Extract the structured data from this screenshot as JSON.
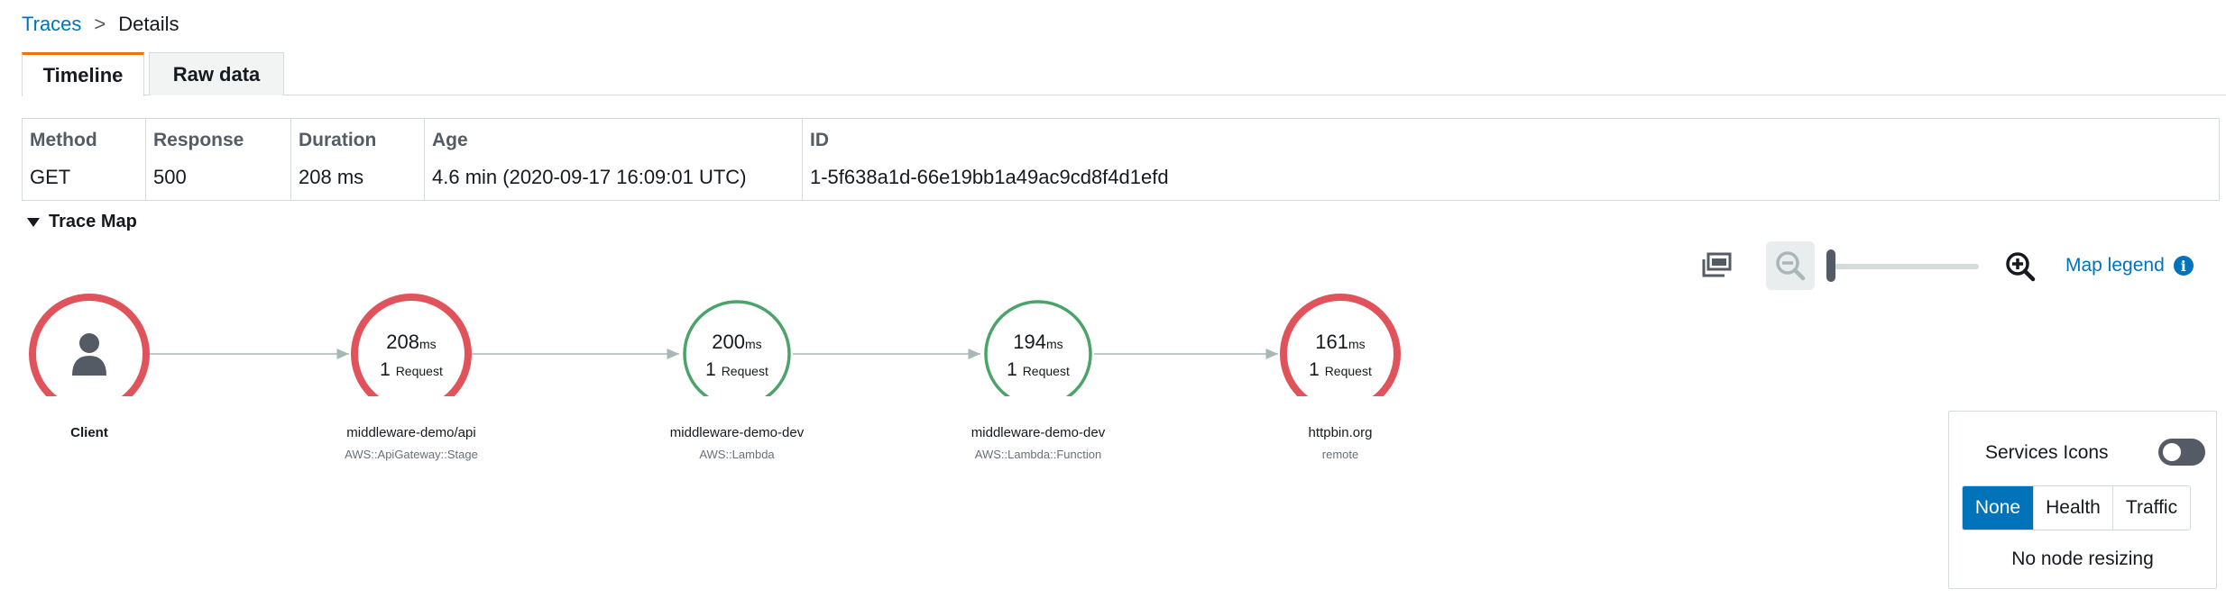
{
  "breadcrumb": {
    "parent": "Traces",
    "separator": ">",
    "current": "Details"
  },
  "tabs": [
    {
      "label": "Timeline",
      "active": true
    },
    {
      "label": "Raw data",
      "active": false
    }
  ],
  "summary": {
    "headers": {
      "method": "Method",
      "response": "Response",
      "duration": "Duration",
      "age": "Age",
      "id": "ID"
    },
    "values": {
      "method": "GET",
      "response": "500",
      "duration": "208 ms",
      "age": "4.6 min (2020-09-17 16:09:01 UTC)",
      "id": "1-5f638a1d-66e19bb1a49ac9cd8f4d1efd"
    }
  },
  "trace_map": {
    "title": "Trace Map",
    "legend_link": "Map legend"
  },
  "nodes": [
    {
      "name": "Client",
      "type": "",
      "ms": "",
      "ms_unit": "",
      "requests": "",
      "req_unit": "",
      "status": "error",
      "icon": "user-icon"
    },
    {
      "name": "middleware-demo/api",
      "type": "AWS::ApiGateway::Stage",
      "ms": "208",
      "ms_unit": "ms",
      "requests": "1",
      "req_unit": "Request",
      "status": "error"
    },
    {
      "name": "middleware-demo-dev",
      "type": "AWS::Lambda",
      "ms": "200",
      "ms_unit": "ms",
      "requests": "1",
      "req_unit": "Request",
      "status": "ok"
    },
    {
      "name": "middleware-demo-dev",
      "type": "AWS::Lambda::Function",
      "ms": "194",
      "ms_unit": "ms",
      "requests": "1",
      "req_unit": "Request",
      "status": "ok"
    },
    {
      "name": "httpbin.org",
      "type": "remote",
      "ms": "161",
      "ms_unit": "ms",
      "requests": "1",
      "req_unit": "Request",
      "status": "error"
    }
  ],
  "colors": {
    "error": "#e0535b",
    "ok": "#4ba36a",
    "edge": "#aab7b8",
    "accent": "#0073bb",
    "tab_active": "#ec7211"
  },
  "legend_panel": {
    "services_icons_label": "Services Icons",
    "services_icons_on": false,
    "options": [
      "None",
      "Health",
      "Traffic"
    ],
    "selected": "None",
    "resize_text": "No node resizing"
  }
}
